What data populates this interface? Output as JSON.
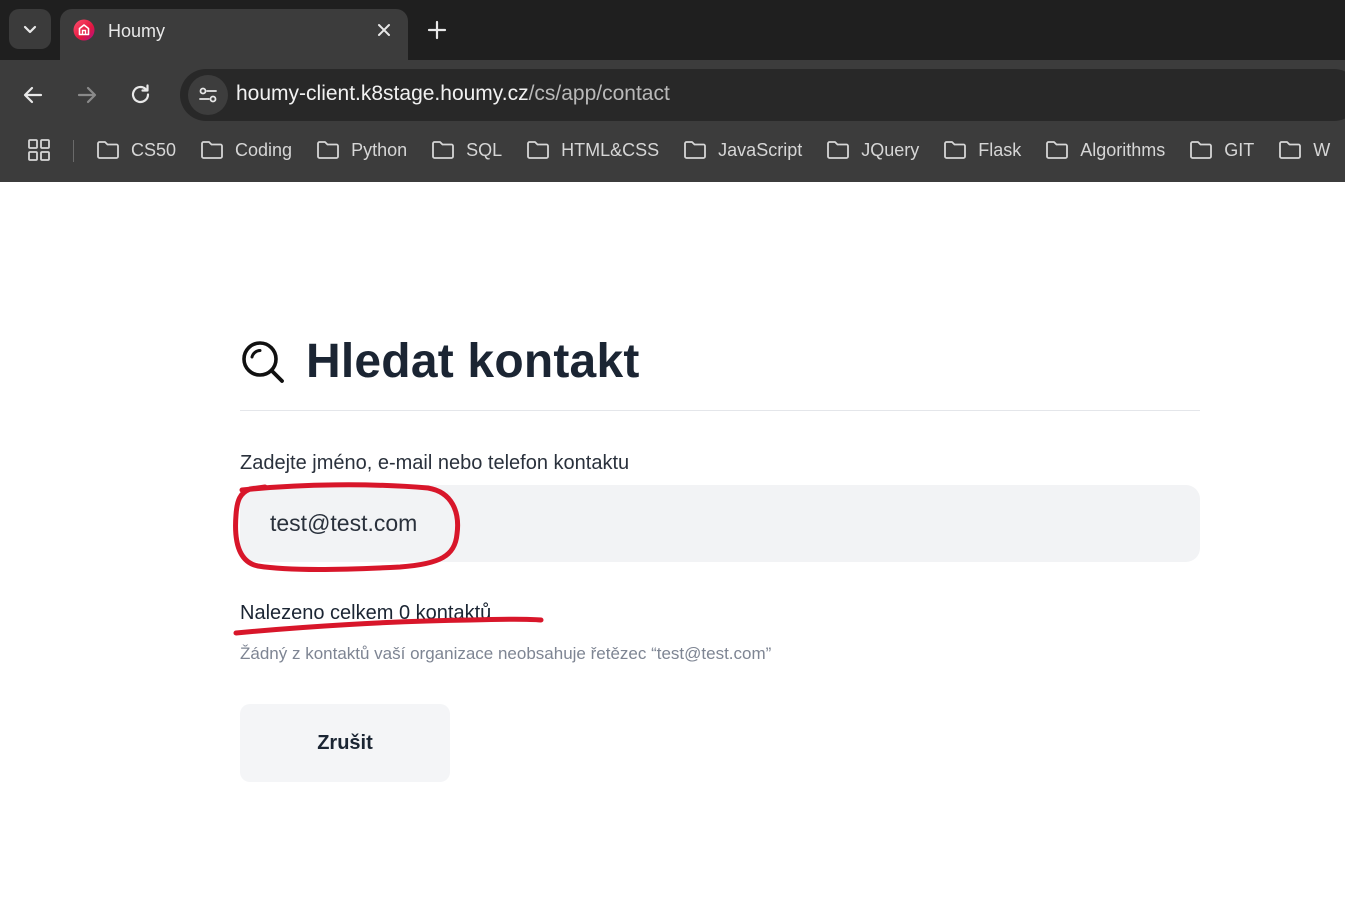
{
  "browser": {
    "tab": {
      "title": "Houmy",
      "favicon": "houmy-logo-icon"
    },
    "url": {
      "host": "houmy-client.k8stage.houmy.cz",
      "path": "/cs/app/contact"
    },
    "bookmarks": [
      "CS50",
      "Coding",
      "Python",
      "SQL",
      "HTML&CSS",
      "JavaScript",
      "JQuery",
      "Flask",
      "Algorithms",
      "GIT",
      "W"
    ]
  },
  "page": {
    "title": "Hledat kontakt",
    "title_icon": "search-icon",
    "search": {
      "label": "Zadejte jméno, e-mail nebo telefon kontaktu",
      "value": "test@test.com"
    },
    "result_count": "Nalezeno celkem 0 kontaktů",
    "result_note": "Žádný z kontaktů vaší organizace neobsahuje řetězec “test@test.com”",
    "cancel_label": "Zrušit"
  },
  "colors": {
    "chrome_dark": "#1f1f1f",
    "chrome_toolbar": "#3c3c3c",
    "heading": "#1b2533",
    "input_bg": "#f2f3f5",
    "annotation_red": "#d8162a"
  }
}
